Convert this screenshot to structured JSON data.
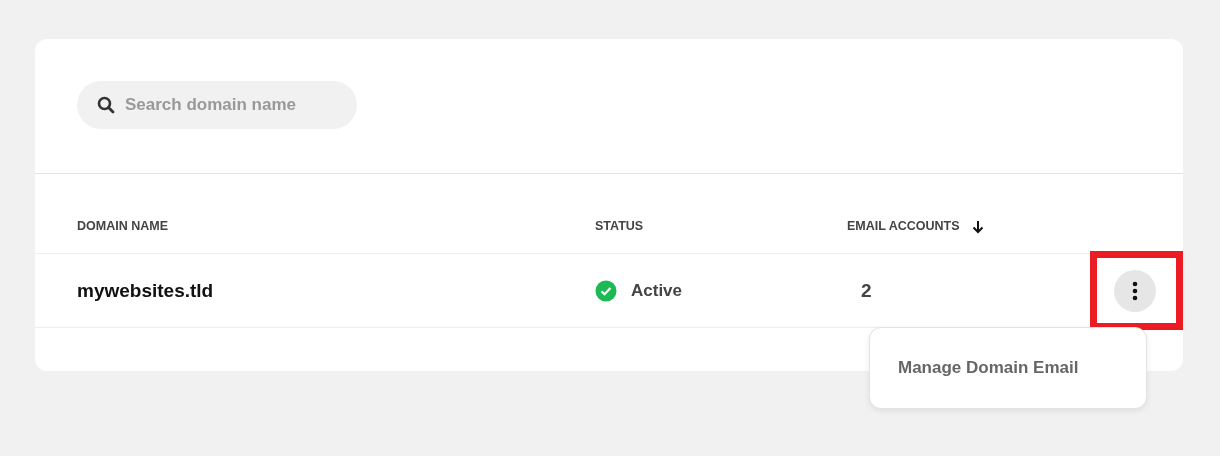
{
  "search": {
    "placeholder": "Search domain name"
  },
  "table": {
    "columns": [
      {
        "label": "DOMAIN NAME",
        "sorted_descending": false
      },
      {
        "label": "STATUS",
        "sorted_descending": false
      },
      {
        "label": "EMAIL ACCOUNTS",
        "sorted_descending": true
      }
    ],
    "rows": [
      {
        "domain": "mywebsites.tld",
        "status": {
          "kind": "active",
          "label": "Active"
        },
        "email_accounts": "2",
        "actions_highlighted": true,
        "menu_open": true,
        "menu_items": [
          "Manage Domain Email"
        ]
      }
    ]
  }
}
